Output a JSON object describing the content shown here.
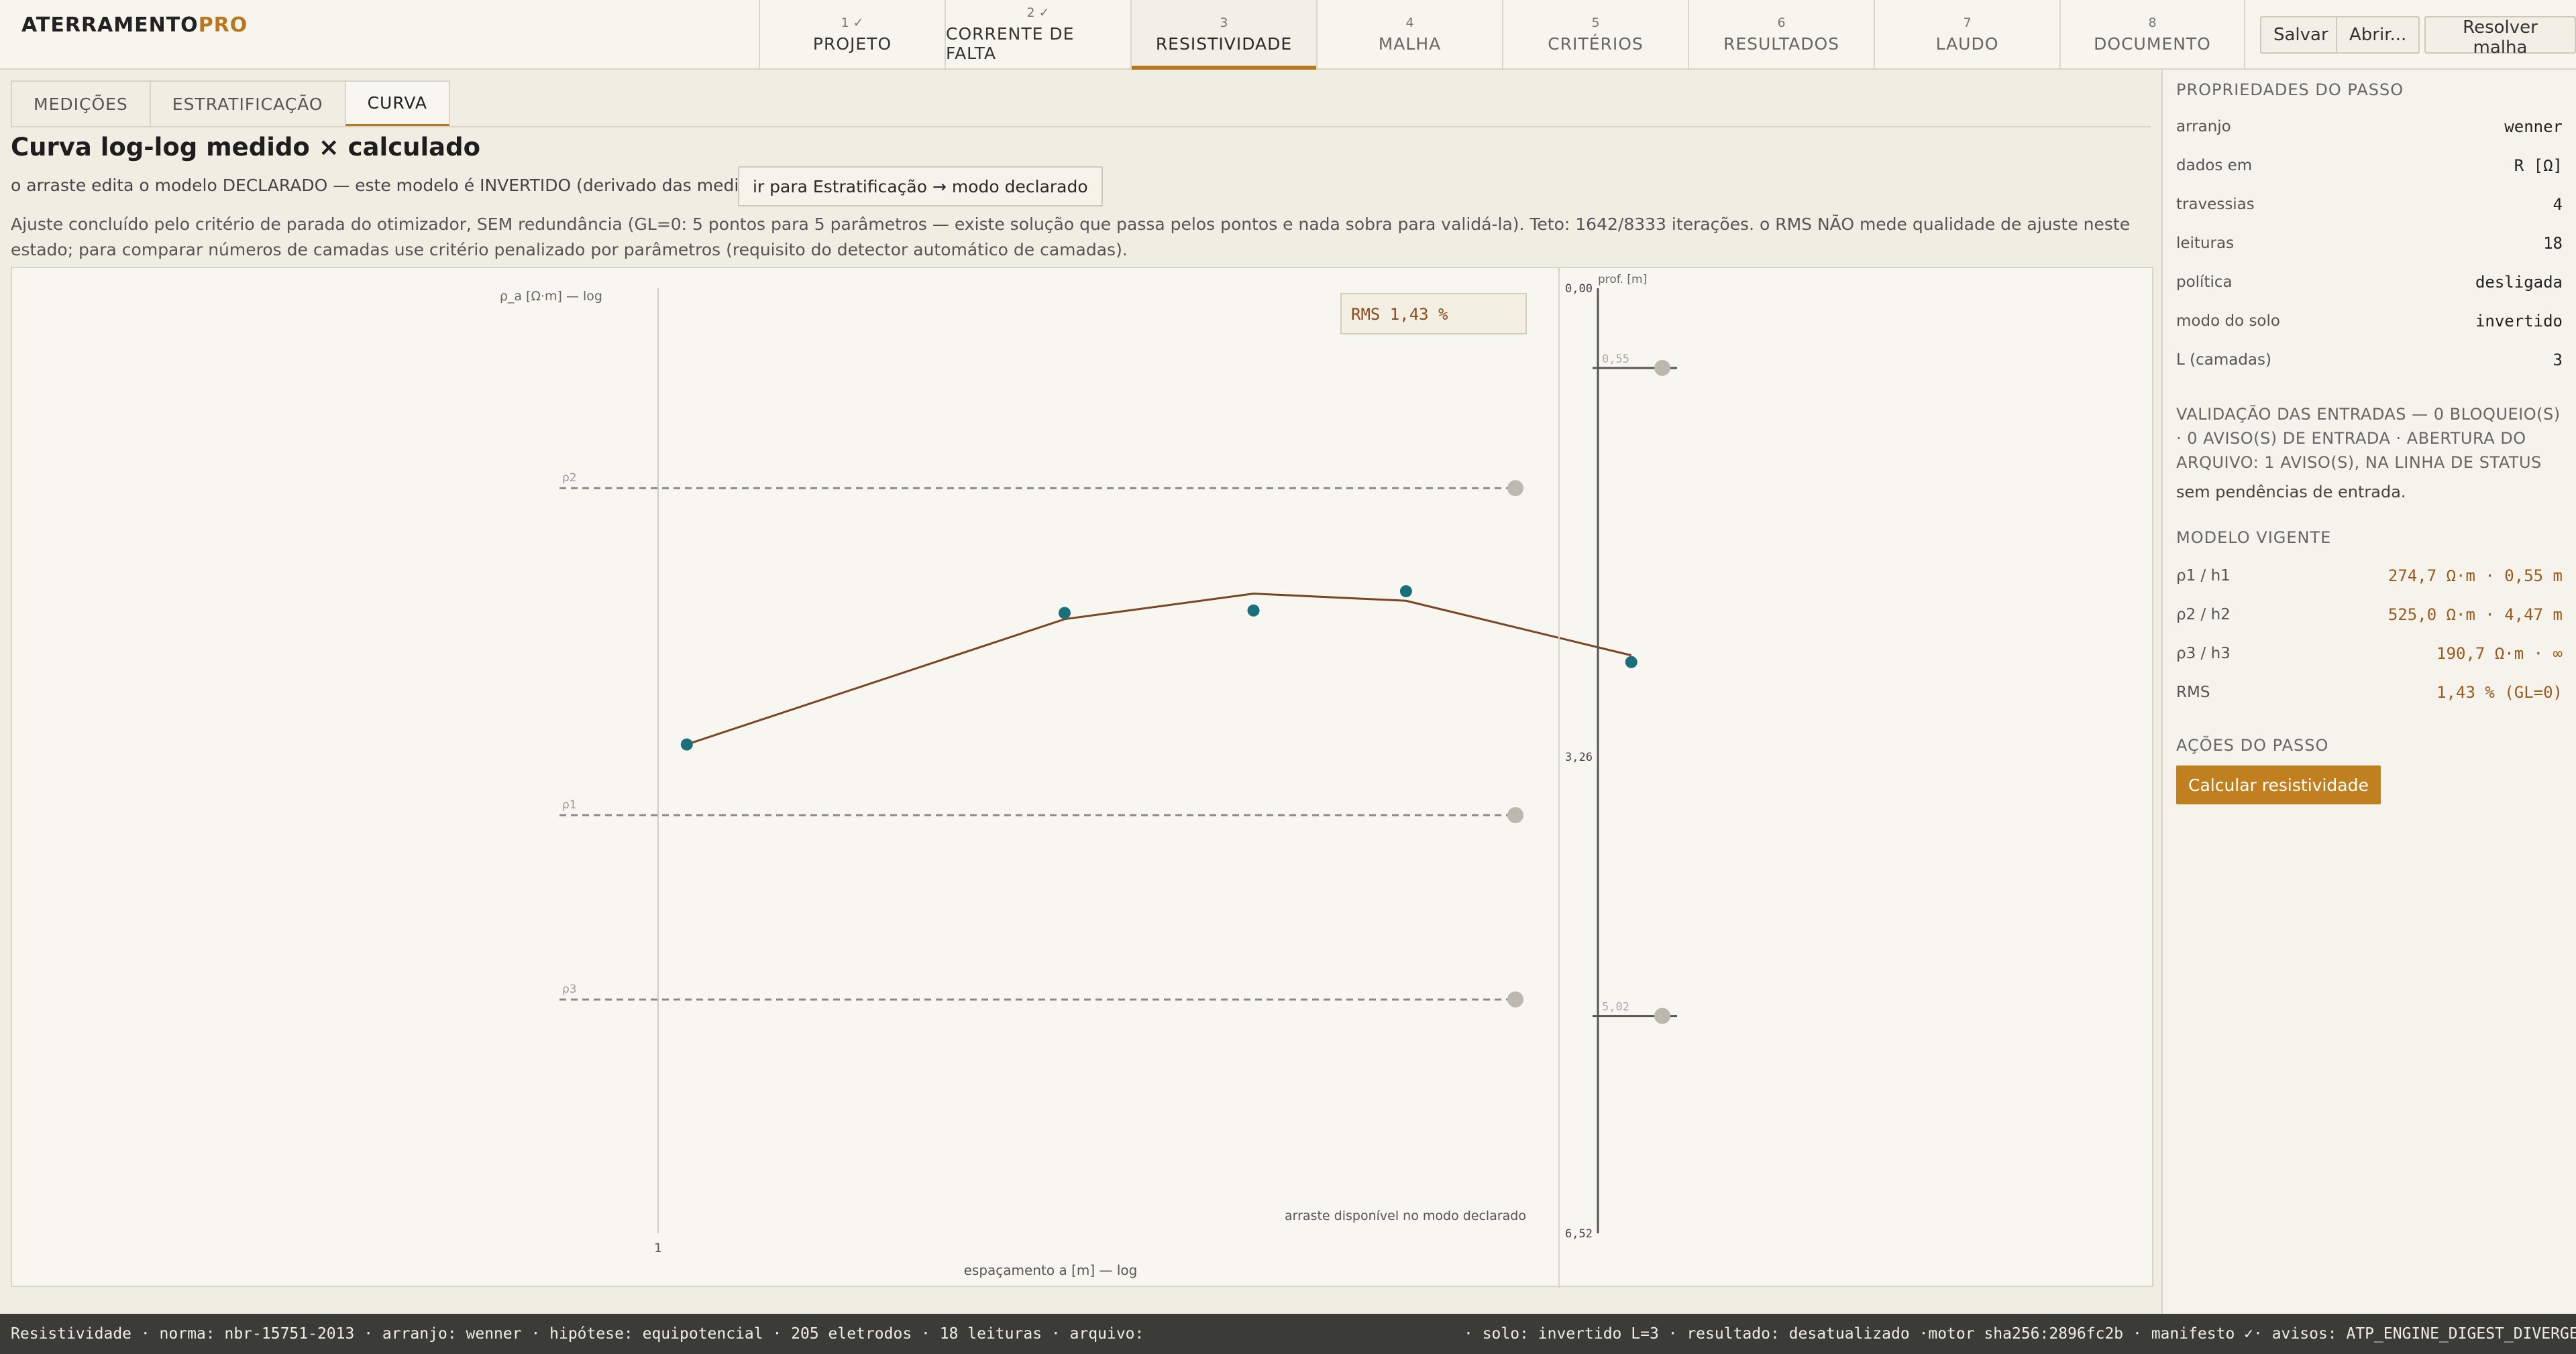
{
  "app": {
    "logo_main": "ATERRAMENTO",
    "logo_accent": "PRO"
  },
  "steps": [
    {
      "num": "1 ✓",
      "label": "PROJETO",
      "state": "done"
    },
    {
      "num": "2 ✓",
      "label": "CORRENTE DE FALTA",
      "state": "done"
    },
    {
      "num": "3",
      "label": "RESISTIVIDADE",
      "state": "active"
    },
    {
      "num": "4",
      "label": "MALHA",
      "state": "todo"
    },
    {
      "num": "5",
      "label": "CRITÉRIOS",
      "state": "todo"
    },
    {
      "num": "6",
      "label": "RESULTADOS",
      "state": "todo"
    },
    {
      "num": "7",
      "label": "LAUDO",
      "state": "todo"
    },
    {
      "num": "8",
      "label": "DOCUMENTO",
      "state": "todo"
    }
  ],
  "header_actions": {
    "save": "Salvar",
    "open": "Abrir...",
    "solve": "Resolver malha"
  },
  "subtabs": [
    {
      "label": "MEDIÇÕES",
      "active": false
    },
    {
      "label": "ESTRATIFICAÇÃO",
      "active": false
    },
    {
      "label": "CURVA",
      "active": true
    }
  ],
  "main": {
    "title": "Curva log-log medido × calculado",
    "note": "o arraste edita o modelo DECLARADO — este modelo é INVERTIDO (derivado das medições).",
    "go_button": "ir para Estratificação → modo declarado",
    "warning": "Ajuste concluído pelo critério de parada do otimizador, SEM redundância (GL=0: 5 pontos para 5 parâmetros — existe solução que passa pelos pontos e nada sobra para validá-la). Teto: 1642/8333 iterações. o RMS NÃO mede qualidade de ajuste neste estado; para comparar números de camadas use critério penalizado por parâmetros (requisito do detector automático de camadas)."
  },
  "chart_data": {
    "type": "line",
    "ylabel": "ρ_a [Ω·m] — log",
    "xlabel": "espaçamento a [m] — log",
    "x_tick_labels": [
      "1"
    ],
    "rms_label": "RMS 1,43 %",
    "drag_note": "arraste disponível no modo declarado",
    "x_scale": "log",
    "y_scale": "log",
    "x_range": [
      0.9,
      18
    ],
    "y_range": [
      120,
      780
    ],
    "grid": false,
    "levels": [
      {
        "name": "ρ2",
        "value": 525.0
      },
      {
        "name": "ρ1",
        "value": 274.7
      },
      {
        "name": "ρ3",
        "value": 190.7
      }
    ],
    "measured": {
      "x": [
        1,
        4,
        8,
        14,
        32
      ],
      "y": [
        316,
        410,
        412,
        428,
        372
      ]
    },
    "calculated": {
      "x": [
        1,
        4,
        8,
        14,
        32
      ],
      "y": [
        316,
        405,
        426,
        420,
        377
      ]
    },
    "depth": {
      "label": "prof. [m]",
      "range": [
        0,
        6.52
      ],
      "tick_labels": [
        "0,00",
        "3,26",
        "6,52"
      ],
      "ticks": [
        0,
        3.26,
        6.52
      ],
      "interfaces": [
        {
          "label": "0,55",
          "value": 0.55
        },
        {
          "label": "5,02",
          "value": 5.02
        }
      ]
    }
  },
  "sidebar": {
    "props_title": "PROPRIEDADES DO PASSO",
    "props": [
      {
        "k": "arranjo",
        "v": "wenner"
      },
      {
        "k": "dados em",
        "v": "R [Ω]"
      },
      {
        "k": "travessias",
        "v": "4"
      },
      {
        "k": "leituras",
        "v": "18"
      },
      {
        "k": "política",
        "v": "desligada"
      },
      {
        "k": "modo do solo",
        "v": "invertido"
      },
      {
        "k": "L (camadas)",
        "v": "3"
      }
    ],
    "validation_text": "VALIDAÇÃO DAS ENTRADAS — 0 BLOQUEIO(S) · 0 AVISO(S) DE ENTRADA · ABERTURA DO ARQUIVO: 1 AVISO(S), NA LINHA DE STATUS",
    "validation_ok": "sem pendências de entrada.",
    "model_title": "MODELO VIGENTE",
    "model": [
      {
        "k": "ρ1 / h1",
        "v": "274,7 Ω·m · 0,55 m"
      },
      {
        "k": "ρ2 / h2",
        "v": "525,0 Ω·m · 4,47 m"
      },
      {
        "k": "ρ3 / h3",
        "v": "190,7 Ω·m · ∞"
      },
      {
        "k": "RMS",
        "v": "1,43 % (GL=0)"
      }
    ],
    "actions_title": "AÇÕES DO PASSO",
    "calc_button": "Calcular resistividade"
  },
  "statusbar": {
    "left": "Resistividade · norma: nbr-15751-2013 · arranjo: wenner · hipótese: equipotencial · 205 eletrodos · 18 leituras · arquivo:",
    "right": "· solo: invertido L=3 · resultado: desatualizado ·motor sha256:2896fc2b · manifesto ✓· avisos: ATP_ENGINE_DIGEST_DIVERGENTE: c"
  },
  "colors": {
    "accent": "#b8781e",
    "measured": "#1a6f7a",
    "calculated": "#7a4520",
    "level": "#8a8a8a",
    "statusbar": "#3b3b38"
  }
}
